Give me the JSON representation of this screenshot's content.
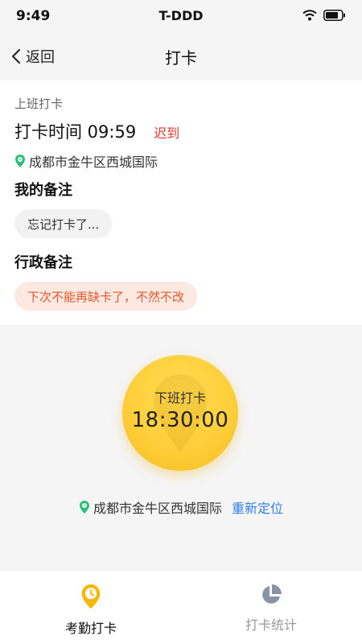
{
  "status_bar": {
    "time": "9:49",
    "carrier": "T-DDD"
  },
  "nav": {
    "back_label": "返回",
    "title": "打卡"
  },
  "record": {
    "section_label": "上班打卡",
    "time_text": "打卡时间 09:59",
    "late_badge": "迟到",
    "location": "成都市金牛区西城国际",
    "my_note_heading": "我的备注",
    "my_note": "忘记打卡了...",
    "admin_note_heading": "行政备注",
    "admin_note": "下次不能再缺卡了，不然不改"
  },
  "clock": {
    "label": "下班打卡",
    "time": "18:30:00",
    "location": "成都市金牛区西城国际",
    "relocate_label": "重新定位"
  },
  "tabs": [
    {
      "label": "考勤打卡",
      "icon": "clock-pin-icon",
      "active": true
    },
    {
      "label": "打卡统计",
      "icon": "pie-chart-icon",
      "active": false
    }
  ],
  "colors": {
    "accent_yellow": "#ffce3a",
    "late_red": "#e53935",
    "admin_note_text": "#e8552a",
    "admin_note_bg": "#fde9e1",
    "link_blue": "#2f80ed",
    "location_green": "#2bbf7e"
  }
}
